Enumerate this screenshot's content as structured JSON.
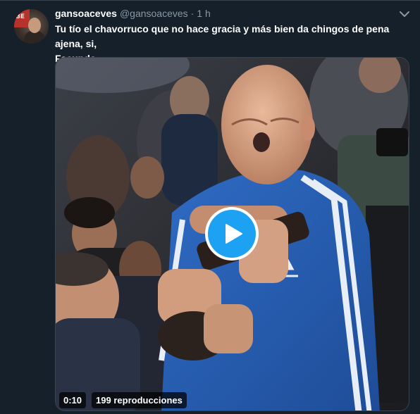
{
  "tweet": {
    "display_name": "gansoaceves",
    "handle": "@gansoaceves",
    "separator": "·",
    "time": "1 h",
    "text_line1": "Tu tío el chavorruco que no hace gracia y más bien da chingos de pena ajena, si,",
    "text_line2": "Facundo.",
    "avatar_text": "BE"
  },
  "video": {
    "duration": "0:10",
    "views": "199 reproducciones",
    "play_icon": "play-icon",
    "menu_icon": "chevron-down-icon"
  },
  "colors": {
    "background": "#15202b",
    "accent": "#1da1f2",
    "muted_text": "#8899a6",
    "border": "#38444d"
  }
}
